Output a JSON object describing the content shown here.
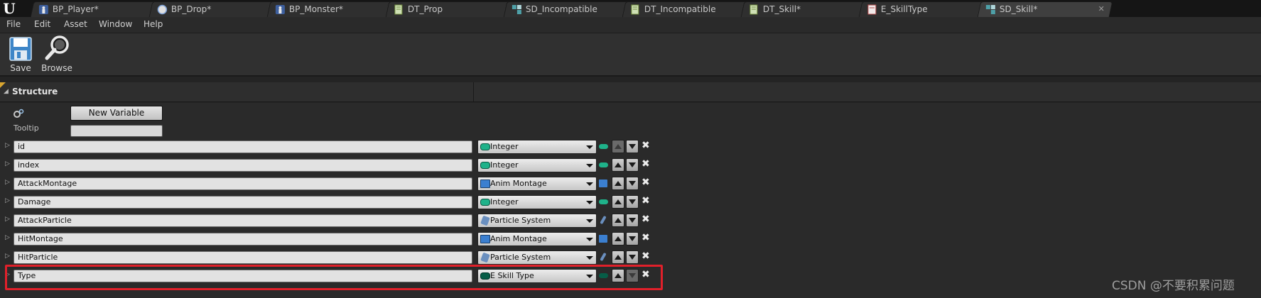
{
  "tabs": [
    {
      "label": "BP_Player*",
      "icon": "pawn-icon"
    },
    {
      "label": "BP_Drop*",
      "icon": "sphere-icon"
    },
    {
      "label": "BP_Monster*",
      "icon": "pawn-icon"
    },
    {
      "label": "DT_Prop",
      "icon": "datatable-icon"
    },
    {
      "label": "SD_Incompatible",
      "icon": "struct-icon"
    },
    {
      "label": "DT_Incompatible",
      "icon": "datatable-icon"
    },
    {
      "label": "DT_Skill*",
      "icon": "datatable-icon"
    },
    {
      "label": "E_SkillType",
      "icon": "enum-icon"
    },
    {
      "label": "SD_Skill*",
      "icon": "struct-icon"
    }
  ],
  "menu": [
    "File",
    "Edit",
    "Asset",
    "Window",
    "Help"
  ],
  "toolbar": {
    "save_label": "Save",
    "browse_label": "Browse"
  },
  "structure": {
    "title": "Structure",
    "new_variable_label": "New Variable",
    "tooltip_label": "Tooltip",
    "tooltip_value": ""
  },
  "variables": [
    {
      "name": "id",
      "type": "Integer",
      "kind": "integer"
    },
    {
      "name": "index",
      "type": "Integer",
      "kind": "integer"
    },
    {
      "name": "AttackMontage",
      "type": "Anim Montage",
      "kind": "anim"
    },
    {
      "name": "Damage",
      "type": "Integer",
      "kind": "integer"
    },
    {
      "name": "AttackParticle",
      "type": "Particle System",
      "kind": "particle"
    },
    {
      "name": "HitMontage",
      "type": "Anim Montage",
      "kind": "anim"
    },
    {
      "name": "HitParticle",
      "type": "Particle System",
      "kind": "particle"
    },
    {
      "name": "Type",
      "type": "E Skill Type",
      "kind": "enum"
    }
  ],
  "colors": {
    "integer_pin": "#1fb28a",
    "enum_pin": "#075d47",
    "anim_pin": "#3b7fd0",
    "particle_pin": "#6a8fbf",
    "highlight": "#e0202a",
    "tab_accent": "#d8a530"
  },
  "watermark": "CSDN @不要积累问题"
}
